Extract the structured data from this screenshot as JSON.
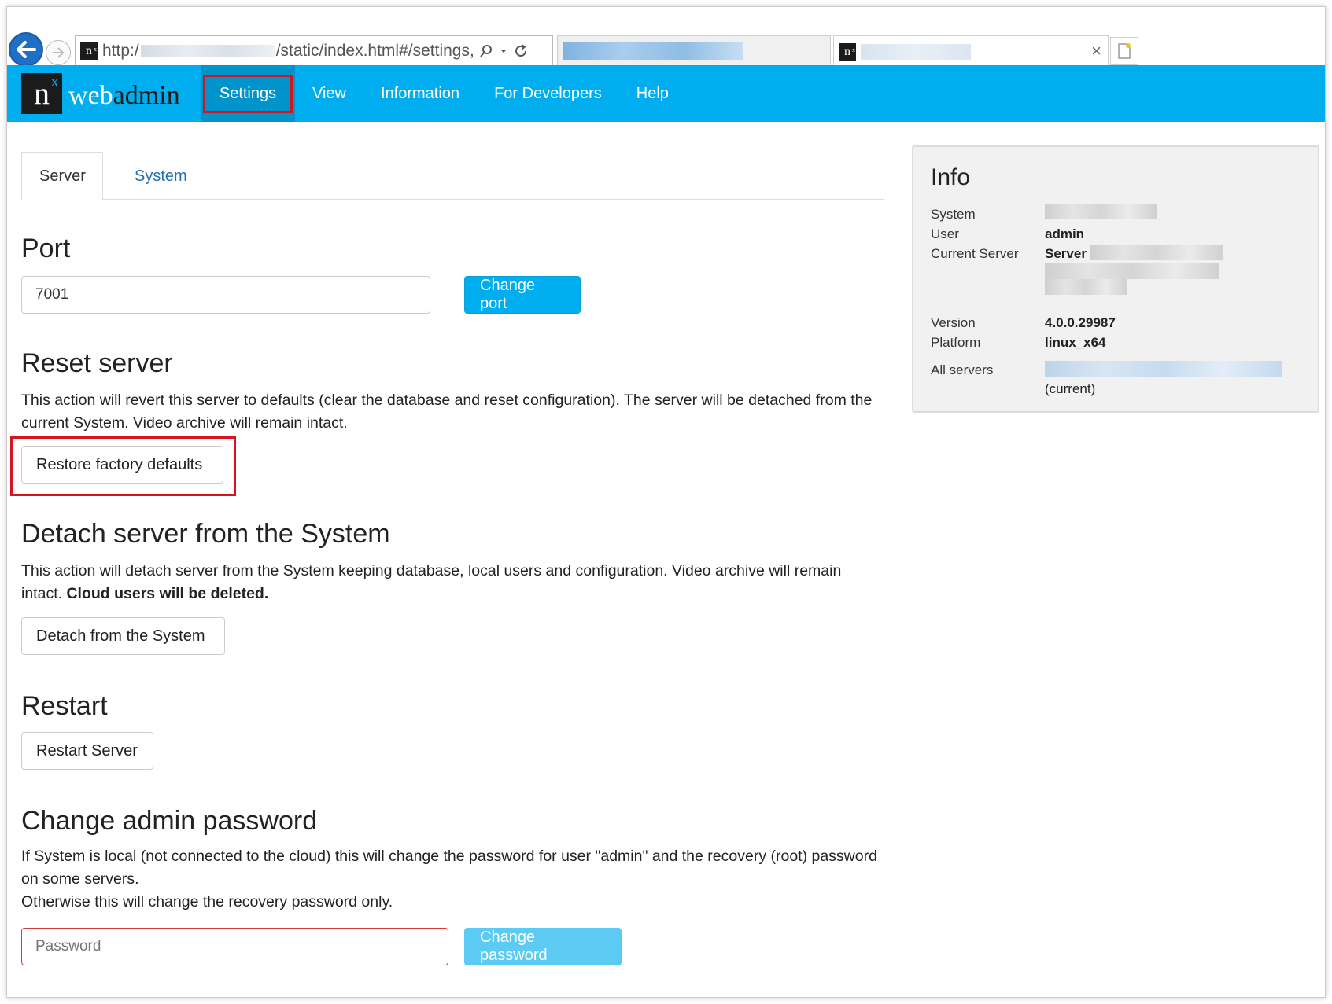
{
  "browser": {
    "url_prefix": "http:/",
    "url_suffix": "/static/index.html#/settings,",
    "search_icon": "search-icon",
    "refresh_icon": "refresh-icon",
    "tab_close": "×"
  },
  "navbar": {
    "logo_letter": "n",
    "logo_super": "x",
    "brand_web": "web",
    "brand_admin": "admin",
    "items": [
      {
        "label": "Settings",
        "active": true
      },
      {
        "label": "View"
      },
      {
        "label": "Information"
      },
      {
        "label": "For Developers"
      },
      {
        "label": "Help"
      }
    ]
  },
  "tabs": [
    {
      "label": "Server",
      "selected": true
    },
    {
      "label": "System"
    }
  ],
  "port": {
    "heading": "Port",
    "value": "7001",
    "button": "Change port"
  },
  "reset": {
    "heading": "Reset server",
    "description": "This action will revert this server to defaults (clear the database and reset configuration). The server will be detached from the current System. Video archive will remain intact.",
    "button": "Restore factory defaults"
  },
  "detach": {
    "heading": "Detach server from the System",
    "description": "This action will detach server from the System keeping database, local users and configuration. Video archive will remain intact.",
    "description_bold": "Cloud users will be deleted.",
    "button": "Detach from the System"
  },
  "restart": {
    "heading": "Restart",
    "button": "Restart Server"
  },
  "password": {
    "heading": "Change admin password",
    "line1": "If System is local (not connected to the cloud) this will change the password for user \"admin\" and the recovery (root) password on some servers.",
    "line2": "Otherwise this will change the recovery password only.",
    "placeholder": "Password",
    "button": "Change password"
  },
  "info": {
    "title": "Info",
    "system_label": "System",
    "user_label": "User",
    "user_value": "admin",
    "current_server_label": "Current Server",
    "current_server_value": "Server",
    "version_label": "Version",
    "version_value": "4.0.0.29987",
    "platform_label": "Platform",
    "platform_value": "linux_x64",
    "all_servers_label": "All servers",
    "all_servers_note": "(current)"
  },
  "colors": {
    "navbar": "#00aeef",
    "highlight_box": "#d4141e",
    "link": "#1f6fb5"
  }
}
